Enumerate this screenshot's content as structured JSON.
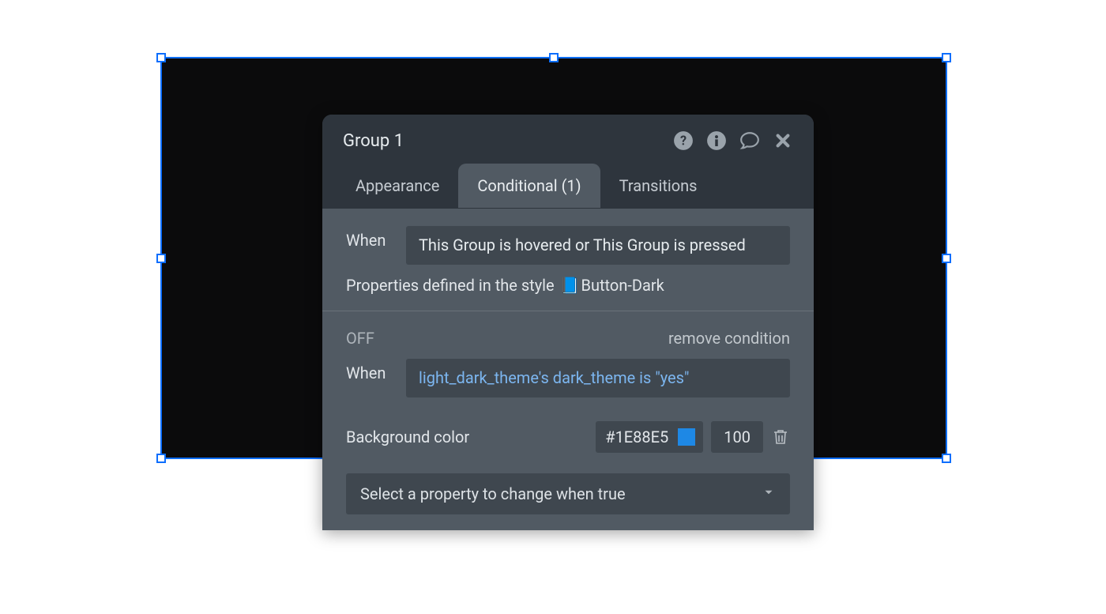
{
  "panel": {
    "title": "Group 1",
    "tabs": {
      "appearance": "Appearance",
      "conditional": "Conditional (1)",
      "transitions": "Transitions"
    },
    "style_condition": {
      "when_label": "When",
      "expression": "This Group is hovered or This Group is pressed",
      "style_prefix": "Properties defined in the style ",
      "style_emoji": "📘",
      "style_name": "Button-Dark"
    },
    "custom_condition": {
      "off_label": "OFF",
      "remove_label": "remove condition",
      "when_label": "When",
      "expression": "light_dark_theme's dark_theme is \"yes\"",
      "property_label": "Background color",
      "hex": "#1E88E5",
      "opacity": "100"
    },
    "select_placeholder": "Select a property to change when true"
  }
}
